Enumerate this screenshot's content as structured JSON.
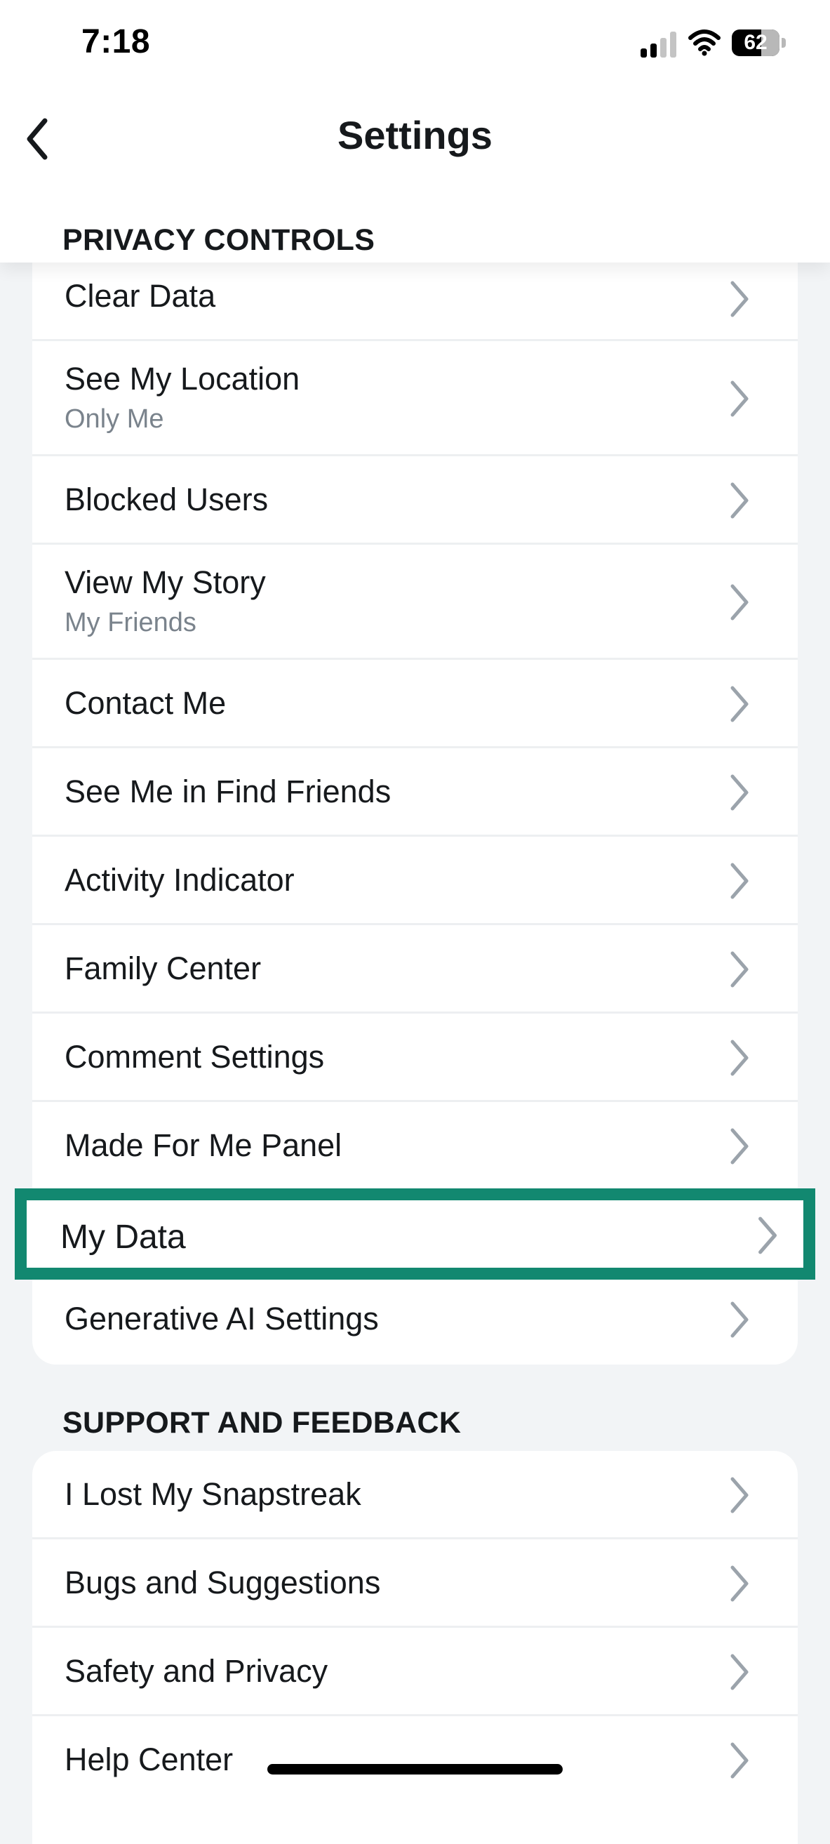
{
  "status_bar": {
    "time": "7:18",
    "battery": "62"
  },
  "nav": {
    "title": "Settings",
    "back_icon": "chevron-left-icon"
  },
  "sections": {
    "privacy": {
      "label": "PRIVACY CONTROLS",
      "items": [
        {
          "label": "Clear Data"
        },
        {
          "label": "See My Location",
          "value": "Only Me"
        },
        {
          "label": "Blocked Users"
        },
        {
          "label": "View My Story",
          "value": "My Friends"
        },
        {
          "label": "Contact Me"
        },
        {
          "label": "See Me in Find Friends"
        },
        {
          "label": "Activity Indicator"
        },
        {
          "label": "Family Center"
        },
        {
          "label": "Comment Settings"
        },
        {
          "label": "Made For Me Panel"
        },
        {
          "label": "My Data",
          "highlighted": true
        },
        {
          "label": "Generative AI Settings"
        }
      ]
    },
    "support": {
      "label": "SUPPORT AND FEEDBACK",
      "items": [
        {
          "label": "I Lost My Snapstreak"
        },
        {
          "label": "Bugs and Suggestions"
        },
        {
          "label": "Safety and Privacy"
        },
        {
          "label": "Help Center"
        }
      ]
    }
  },
  "colors": {
    "highlight_border": "#128870",
    "background": "#F2F4F6",
    "secondary_text": "#7A838C",
    "chevron": "#9BA3AB"
  }
}
